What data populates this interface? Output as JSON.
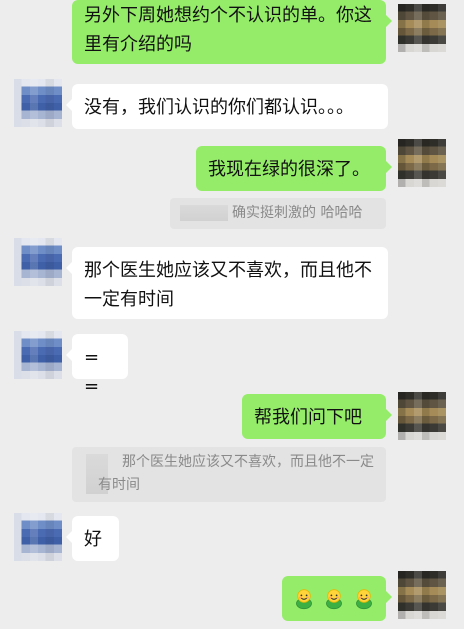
{
  "messages": {
    "m1": {
      "text": "另外下周她想约个不认识的单。你这里有介绍的吗"
    },
    "m2": {
      "text": "没有，我们认识的你们都认识。。。"
    },
    "m3": {
      "text": "我现在绿的很深了。"
    },
    "q1": {
      "text": "确实挺刺激的 哈哈哈"
    },
    "m4": {
      "text": "那个医生她应该又不喜欢，而且他不一定有时间"
    },
    "m5": {
      "text": "= ="
    },
    "m6": {
      "text": "帮我们问下吧"
    },
    "q2": {
      "text": "那个医生她应该又不喜欢，而且他不一定有时间"
    },
    "m7": {
      "text": "好"
    },
    "m8": {
      "emoji_icons": [
        "smiling-face-icon",
        "smiling-face-icon",
        "smiling-face-icon"
      ]
    }
  }
}
